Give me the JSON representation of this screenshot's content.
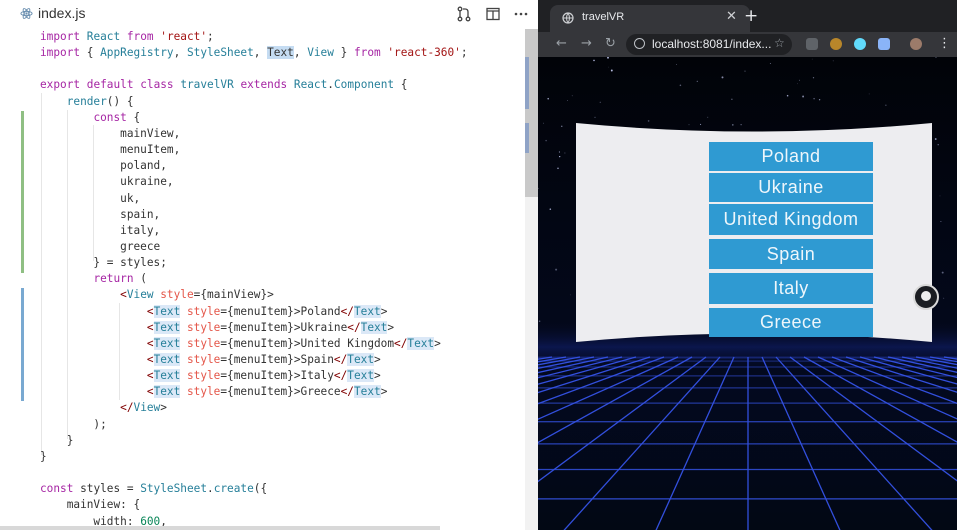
{
  "editor": {
    "file_name": "index.js",
    "code_lines": [
      "import React from 'react';",
      "import { AppRegistry, StyleSheet, Text, View } from 'react-360';",
      "",
      "export default class travelVR extends React.Component {",
      "    render() {",
      "        const {",
      "            mainView,",
      "            menuItem,",
      "            poland,",
      "            ukraine,",
      "            uk,",
      "            spain,",
      "            italy,",
      "            greece",
      "        } = styles;",
      "        return (",
      "            <View style={mainView}>",
      "                <Text style={menuItem}>Poland</Text>",
      "                <Text style={menuItem}>Ukraine</Text>",
      "                <Text style={menuItem}>United Kingdom</Text>",
      "                <Text style={menuItem}>Spain</Text>",
      "                <Text style={menuItem}>Italy</Text>",
      "                <Text style={menuItem}>Greece</Text>",
      "            </View>",
      "        );",
      "    }",
      "}",
      "",
      "const styles = StyleSheet.create({",
      "    mainView: {",
      "        width: 600,"
    ]
  },
  "browser": {
    "tab_title": "travelVR",
    "url": "localhost:8081/index...",
    "menu_items": [
      "Poland",
      "Ukraine",
      "United Kingdom",
      "Spain",
      "Italy",
      "Greece"
    ]
  },
  "colors": {
    "menu_item_bg": "#2f9ad2",
    "panel_bg": "#ededf0",
    "grid_line": "#3b5cff"
  },
  "icons": [
    "react-file-icon",
    "source-control-icon",
    "split-editor-icon",
    "more-icon",
    "globe-icon",
    "back-icon",
    "forward-icon",
    "reload-icon",
    "info-icon",
    "star-icon",
    "gaze-cursor-icon"
  ]
}
